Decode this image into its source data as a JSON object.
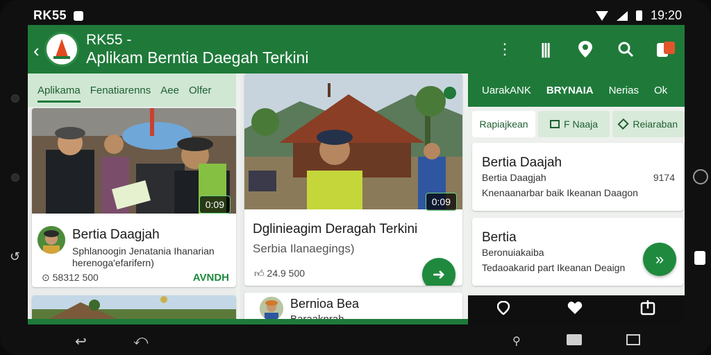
{
  "status": {
    "carrier": "RK55",
    "time": "19:20"
  },
  "appbar": {
    "title_line1": "RK55 -",
    "title_line2": "Aplikam Berntia Daegah Terkini",
    "actions": [
      "more-icon",
      "library-icon",
      "location-icon",
      "search-icon",
      "cart-icon"
    ]
  },
  "left_panel": {
    "tabs": [
      "Aplikama",
      "Fenatiarenns",
      "Aee",
      "Olfer"
    ],
    "card1": {
      "badge": "0:09",
      "title": "Bertia Daagjah",
      "sub_line1": "Sphlanoogin Jenatania Ihanarian",
      "sub_line2": "herenoga'efarifern)",
      "meta": "58312 500",
      "link": "AVNDH"
    },
    "card2": {
      "label": ""
    }
  },
  "mid_panel": {
    "card1": {
      "badge": "0:09",
      "title": "Dglinieagim Deragah Terkini",
      "sub": "Serbia Ilanaegings)",
      "meta": "24.9 500"
    },
    "card2": {
      "title": "Bernioa Bea",
      "sub": "Baraaknrah"
    }
  },
  "right_panel": {
    "tabs": [
      "UarakANK",
      "BRYNAIA",
      "Nerias",
      "Ok"
    ],
    "chips": [
      "Rapiajkean",
      "F Naaja",
      "Reiaraban"
    ],
    "card1": {
      "title": "Bertia Daajah",
      "sub": "Bertia Daagjah",
      "count": "9174",
      "desc": "Knenaanarbar baik Ikeanan Daagon"
    },
    "card2": {
      "title": "Bertia",
      "sub": "Beronuiakaiba",
      "desc": "Tedaoakarid part Ikeanan Deaign"
    }
  }
}
